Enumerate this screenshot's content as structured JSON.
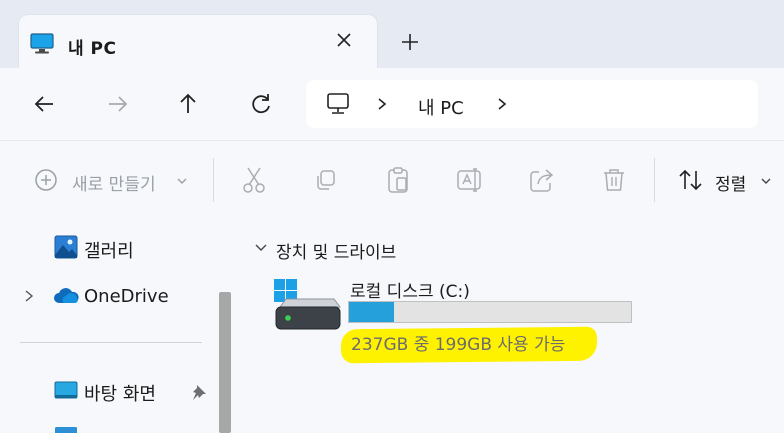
{
  "window": {
    "tab_title": "내 PC"
  },
  "nav": {
    "address_location": "내 PC",
    "address_separator": "›"
  },
  "command_bar": {
    "new_label": "새로 만들기",
    "sort_label": "정렬"
  },
  "sidebar": {
    "items": [
      {
        "label": "갤러리",
        "icon": "gallery-icon"
      },
      {
        "label": "OneDrive",
        "icon": "onedrive-cloud-icon"
      },
      {
        "label": "바탕 화면",
        "icon": "desktop-icon"
      }
    ]
  },
  "main": {
    "section_title": "장치 및 드라이브",
    "drives": [
      {
        "name": "로컬 디스크 (C:)",
        "capacity_text": "237GB 중 199GB 사용 가능",
        "used_fraction": 0.16
      }
    ]
  },
  "colors": {
    "accent": "#26a0da",
    "highlight": "#fff200",
    "onedrive": "#0f6cbd"
  }
}
